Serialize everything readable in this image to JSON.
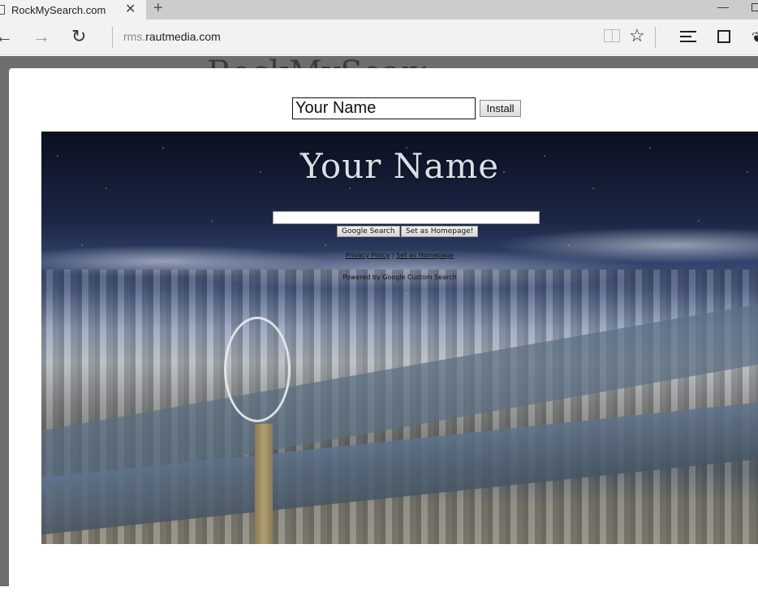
{
  "browser": {
    "tab_title": "RockMySearch.com",
    "address_subdomain": "rms.",
    "address_domain": "rautmedia.com",
    "icons": {
      "back": "←",
      "forward": "→",
      "refresh": "↻",
      "favorite": "☆",
      "close_tab": "✕",
      "new_tab": "+",
      "minimize": "—",
      "share": "❦"
    }
  },
  "background_page": {
    "ghost_text": "RockMySearch"
  },
  "modal": {
    "name_input_value": "Your Name",
    "install_label": "Install"
  },
  "preview": {
    "logo_text": "Your Name",
    "google_search_label": "Google Search",
    "set_homepage_button_label": "Set as Homepage!",
    "privacy_link": "Privacy Policy",
    "link_separator": " | ",
    "set_homepage_link": "Set as Homepage",
    "powered_by": "Powered by Google Custom Search"
  }
}
